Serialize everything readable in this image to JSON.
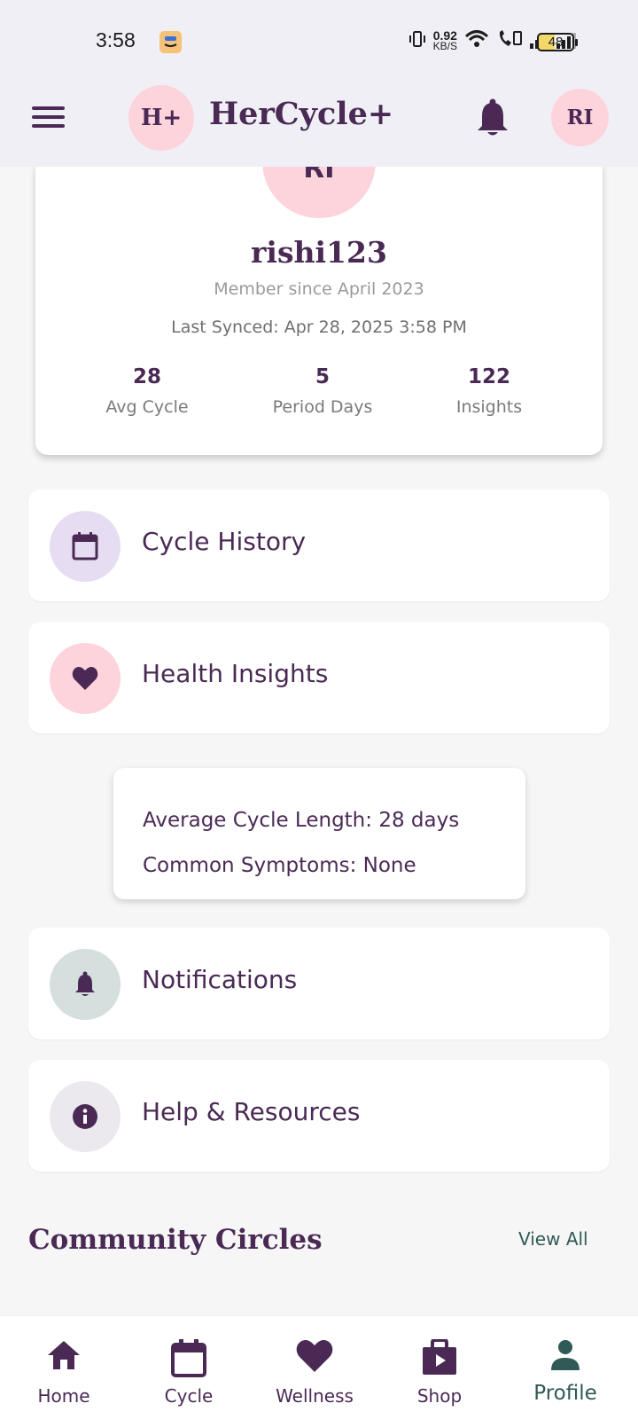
{
  "status_bar": {
    "time": "3:58",
    "net_speed": "0.92",
    "net_unit": "KB/S",
    "battery": "48"
  },
  "app_bar": {
    "logo_text": "H+",
    "title": "HerCycle+",
    "avatar_initials": "RI"
  },
  "profile": {
    "avatar_initials": "RI",
    "username": "rishi123",
    "member_since": "Member since April 2023",
    "last_synced": "Last Synced: Apr 28, 2025 3:58 PM",
    "stats": [
      {
        "value": "28",
        "label": "Avg Cycle"
      },
      {
        "value": "5",
        "label": "Period Days"
      },
      {
        "value": "122",
        "label": "Insights"
      }
    ]
  },
  "menu": {
    "cycle_history": "Cycle History",
    "health_insights": "Health Insights",
    "notifications": "Notifications",
    "help_resources": "Help & Resources"
  },
  "insights_popup": {
    "avg_cycle_length": "Average Cycle Length: 28 days",
    "common_symptoms": "Common Symptoms: None"
  },
  "community": {
    "title": "Community Circles",
    "view_all": "View All"
  },
  "bottom_nav": {
    "home": "Home",
    "cycle": "Cycle",
    "wellness": "Wellness",
    "shop": "Shop",
    "profile": "Profile"
  },
  "colors": {
    "primary": "#4a2a55",
    "pink_accent": "#fdd3dc",
    "lavender": "#e6ddf2",
    "teal_active": "#2f5a55"
  }
}
